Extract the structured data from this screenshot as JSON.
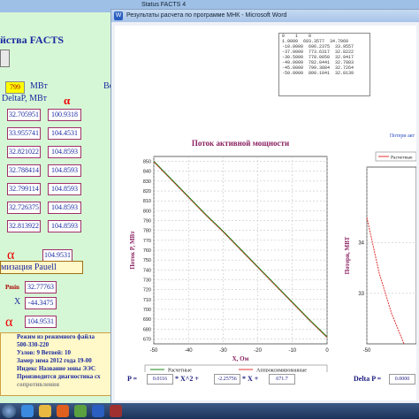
{
  "background_window": {
    "title": "Status FACTS 4",
    "heading": "йства FACTS",
    "mw_value": "799",
    "mw_unit": "МВт",
    "right_fragment": "Ве",
    "delta_label": "DeltaP, МВт",
    "alpha_symbol": "α",
    "table_col1": [
      "32.705951",
      "33.955741",
      "32.821022",
      "32.788414",
      "32.799114",
      "32.726375",
      "32.813922"
    ],
    "table_col2": [
      "100.9318",
      "104.4531",
      "104.8593",
      "104.8593",
      "104.8593",
      "104.8593",
      "104.8593"
    ],
    "alpha_value": "104.9531",
    "optimization_label": "мизация Pauell",
    "pmin_label": "Pmin",
    "pmin_value": "32.77763",
    "x_label": "X",
    "x_value": "-44.3475",
    "alpha2_value": "104.9531",
    "status_lines": [
      "Режим из режимного файла",
      "500-330-220",
      "Узлов: 9 Ветвей: 10",
      "Замер зима 2012 года 19-00",
      "Индекс Название зоны ЭЭС",
      "Производится диагностика сх",
      "сопротивления"
    ]
  },
  "foreground_window": {
    "title": "Результаты расчета по программе МНК - Microsoft Word",
    "data_lines": [
      "0    1    0",
      "",
      "1.0000  603.3577  34.7060",
      "-10.0000  696.2375  33.9557",
      "-37.0000  773.6317  32.8222",
      "-30.5000  778.0050  32.9417",
      "-49.0000  782.0441  32.7883",
      "-45.0000  799.3884  32.7264",
      "-50.0000  800.1041  32.8139"
    ],
    "chart1_title": "Поток активной мощности",
    "chart2_title": "Потери акт",
    "chart2_legend": "Расчетные",
    "chart2_ylabel": "Потери, МВТ",
    "p_equation": {
      "label_p": "P =",
      "a": "0.0116",
      "label_x2": "* X^2 +",
      "b": "-2.25756",
      "label_x": "* X +",
      "c": "671.7"
    },
    "delta_equation": {
      "label": "Delta P =",
      "a": "0.0000"
    }
  },
  "chart_data": [
    {
      "type": "line",
      "title": "Поток активной мощности",
      "xlabel": "X, Ом",
      "ylabel": "Поток P, МВт",
      "xlim": [
        -50,
        0
      ],
      "ylim": [
        665,
        855
      ],
      "x_ticks": [
        -50,
        -40,
        -30,
        -20,
        -10,
        0
      ],
      "y_ticks": [
        670,
        680,
        690,
        700,
        710,
        720,
        730,
        740,
        750,
        760,
        770,
        780,
        790,
        800,
        810,
        820,
        830,
        840,
        850
      ],
      "grid": true,
      "legend": "bottom",
      "series": [
        {
          "name": "Расчетные",
          "color": "#1a8a1a",
          "x": [
            -50,
            -45,
            -40,
            -35,
            -30,
            -25,
            -20,
            -15,
            -10,
            -5,
            0
          ],
          "y": [
            850,
            832,
            814,
            796,
            779,
            761,
            743,
            725,
            707,
            689,
            672
          ]
        },
        {
          "name": "Аппроксимированные",
          "color": "#e03030",
          "x": [
            -50,
            -45,
            -40,
            -35,
            -30,
            -25,
            -20,
            -15,
            -10,
            -5,
            0
          ],
          "y": [
            850,
            832,
            814,
            796,
            779,
            761,
            743,
            725,
            707,
            689,
            672
          ]
        }
      ]
    },
    {
      "type": "line",
      "title": "Потери акт",
      "ylabel": "Потери, МВТ",
      "xlim": [
        -50,
        -30
      ],
      "ylim": [
        32,
        35.5
      ],
      "x_ticks": [
        -50
      ],
      "y_ticks": [
        33,
        34
      ],
      "grid": true,
      "legend": "top-right",
      "series": [
        {
          "name": "Расчетные",
          "color": "#e03030",
          "x": [
            -50,
            -45,
            -40,
            -35
          ],
          "y": [
            34.5,
            33.4,
            32.6,
            31.9
          ]
        }
      ]
    }
  ],
  "colors": {
    "accent_blue": "#1a2aa0",
    "alpha_red": "#e00000",
    "window_green": "#d6f7d6"
  },
  "taskbar_icons": [
    "start-orb-icon",
    "ie-icon",
    "folder-icon",
    "firefox-icon",
    "media-icon",
    "word-icon",
    "app-icon"
  ]
}
